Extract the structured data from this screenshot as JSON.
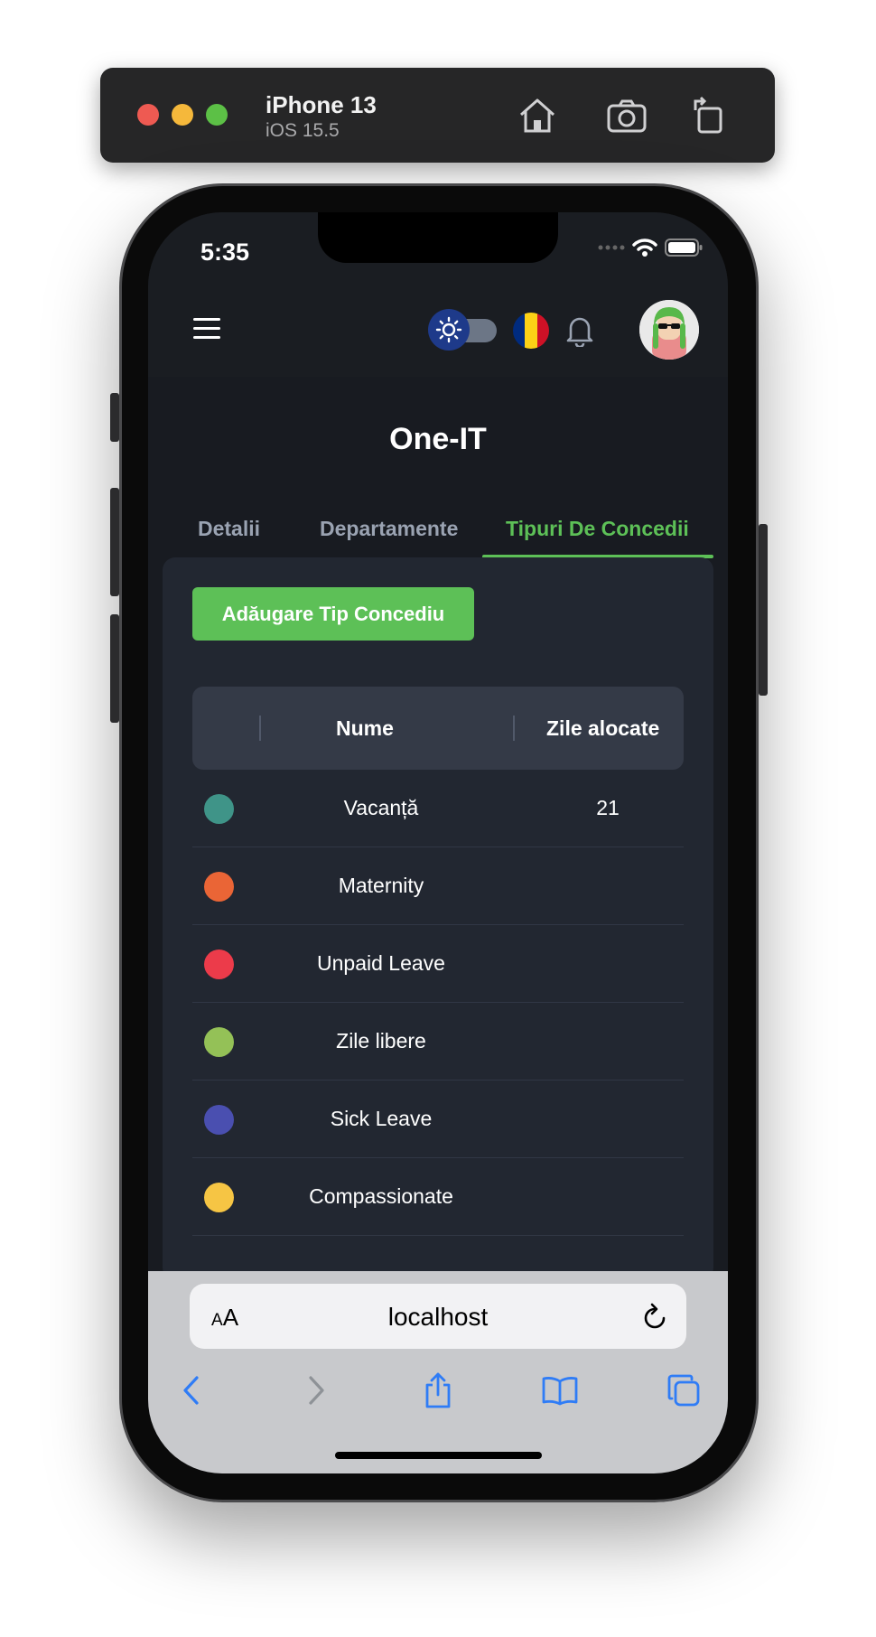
{
  "simulator": {
    "device": "iPhone 13",
    "os": "iOS 15.5"
  },
  "status_bar": {
    "time": "5:35"
  },
  "header": {
    "theme_toggle": "light",
    "language_flag": "RO"
  },
  "page": {
    "title": "One-IT",
    "tabs": [
      {
        "label": "Detalii",
        "active": false
      },
      {
        "label": "Departamente",
        "active": false
      },
      {
        "label": "Tipuri De Concedii",
        "active": true
      }
    ],
    "add_button_label": "Adăugare Tip Concediu",
    "table": {
      "columns": [
        "Nume",
        "Zile alocate"
      ],
      "rows": [
        {
          "color": "#3f9488",
          "name": "Vacanță",
          "days": "21"
        },
        {
          "color": "#ea6536",
          "name": "Maternity",
          "days": ""
        },
        {
          "color": "#ec3b4a",
          "name": "Unpaid Leave",
          "days": ""
        },
        {
          "color": "#94c157",
          "name": "Zile libere",
          "days": ""
        },
        {
          "color": "#4a4fb0",
          "name": "Sick Leave",
          "days": ""
        },
        {
          "color": "#f6c544",
          "name": "Compassionate",
          "days": ""
        }
      ]
    }
  },
  "browser": {
    "text_size_label": "AA",
    "url": "localhost"
  },
  "colors": {
    "accent": "#5dc057",
    "background": "#181b21",
    "card": "#222731"
  }
}
